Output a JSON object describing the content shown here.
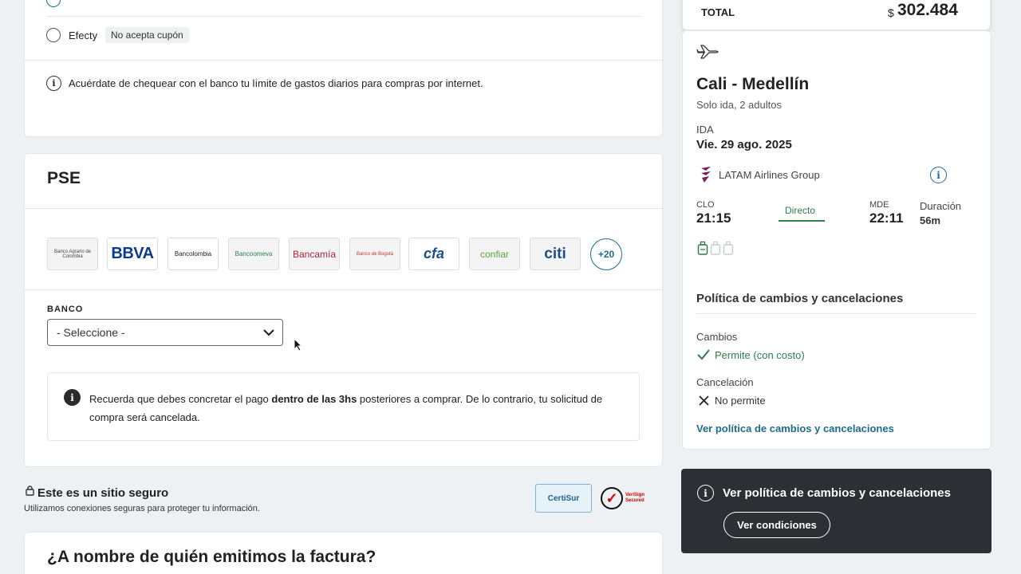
{
  "payment": {
    "efecty_label": "Efecty",
    "efecty_tag": "No acepta cupón",
    "notice": "Acuérdate de chequear con el banco tu límite de gastos diarios para compras por internet."
  },
  "pse": {
    "title": "PSE",
    "banks": [
      "Banco Agrario de Colombia",
      "BBVA",
      "Bancolombia",
      "Bancoomeva",
      "Bancamía",
      "Banco de Bogotá",
      "cfa",
      "confiar",
      "citi"
    ],
    "more": "+20",
    "bank_label": "BANCO",
    "select_value": "- Seleccione -",
    "warning_pre": "Recuerda que debes concretar el pago ",
    "warning_bold": "dentro de las 3hs",
    "warning_post": " posteriores a comprar. De lo contrario, tu solicitud de compra será cancelada."
  },
  "secure": {
    "title": "Este es un sitio seguro",
    "subtitle": "Utilizamos conexiones seguras para proteger tu información.",
    "certisur": "CertiSur",
    "verisign": "VeriSign Secured"
  },
  "invoice": {
    "title": "¿A nombre de quién emitimos la factura?"
  },
  "summary": {
    "total_label": "TOTAL",
    "currency": "$",
    "total_value": "302.484",
    "route": "Cali - Medellín",
    "trip_info": "Solo ida, 2 adultos",
    "ida_label": "IDA",
    "date": "Vie. 29 ago. 2025",
    "airline": "LATAM Airlines Group",
    "origin_code": "CLO",
    "origin_time": "21:15",
    "direct": "Directo",
    "dest_code": "MDE",
    "dest_time": "22:11",
    "duration_label": "Duración",
    "duration": "56m",
    "policy_title": "Política de cambios y cancelaciones",
    "changes_label": "Cambios",
    "changes_value": "Permite (con costo)",
    "cancel_label": "Cancelación",
    "cancel_value": "No permite",
    "policy_link": "Ver política de cambios y cancelaciones"
  },
  "toast": {
    "text": "Ver política de cambios y cancelaciones",
    "button": "Ver condiciones"
  },
  "colors": {
    "accent": "#1f6b8c",
    "success": "#2e7d4f",
    "dark": "#2c2f33"
  }
}
